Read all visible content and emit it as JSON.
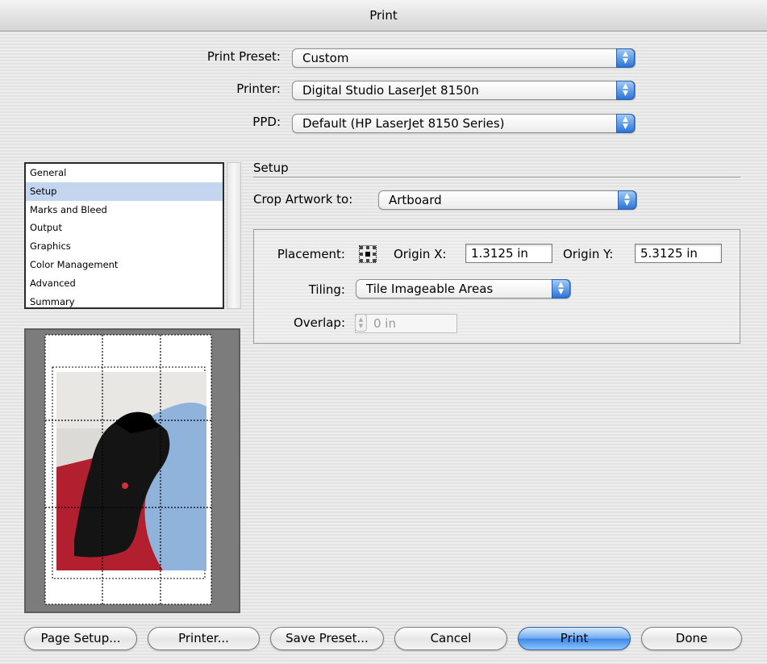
{
  "window": {
    "title": "Print"
  },
  "top": {
    "print_preset_label": "Print Preset:",
    "print_preset_value": "Custom",
    "printer_label": "Printer:",
    "printer_value": "Digital Studio LaserJet 8150n",
    "ppd_label": "PPD:",
    "ppd_value": "Default (HP LaserJet 8150 Series)"
  },
  "sidebar": {
    "items": [
      {
        "label": "General",
        "selected": false
      },
      {
        "label": "Setup",
        "selected": true
      },
      {
        "label": "Marks and Bleed",
        "selected": false
      },
      {
        "label": "Output",
        "selected": false
      },
      {
        "label": "Graphics",
        "selected": false
      },
      {
        "label": "Color Management",
        "selected": false
      },
      {
        "label": "Advanced",
        "selected": false
      },
      {
        "label": "Summary",
        "selected": false
      }
    ]
  },
  "setup": {
    "title": "Setup",
    "crop_label": "Crop Artwork to:",
    "crop_value": "Artboard",
    "placement_label": "Placement:",
    "origin_x_label": "Origin X:",
    "origin_x_value": "1.3125 in",
    "origin_y_label": "Origin Y:",
    "origin_y_value": "5.3125 in",
    "tiling_label": "Tiling:",
    "tiling_value": "Tile Imageable Areas",
    "overlap_label": "Overlap:",
    "overlap_value": "0 in"
  },
  "buttons": {
    "page_setup": "Page Setup...",
    "printer": "Printer...",
    "save_preset": "Save Preset...",
    "cancel": "Cancel",
    "print": "Print",
    "done": "Done"
  },
  "colors": {
    "accent_blue": "#3b86e6",
    "selection": "#c3d5ef",
    "preview_bg": "#7c7c7c"
  }
}
